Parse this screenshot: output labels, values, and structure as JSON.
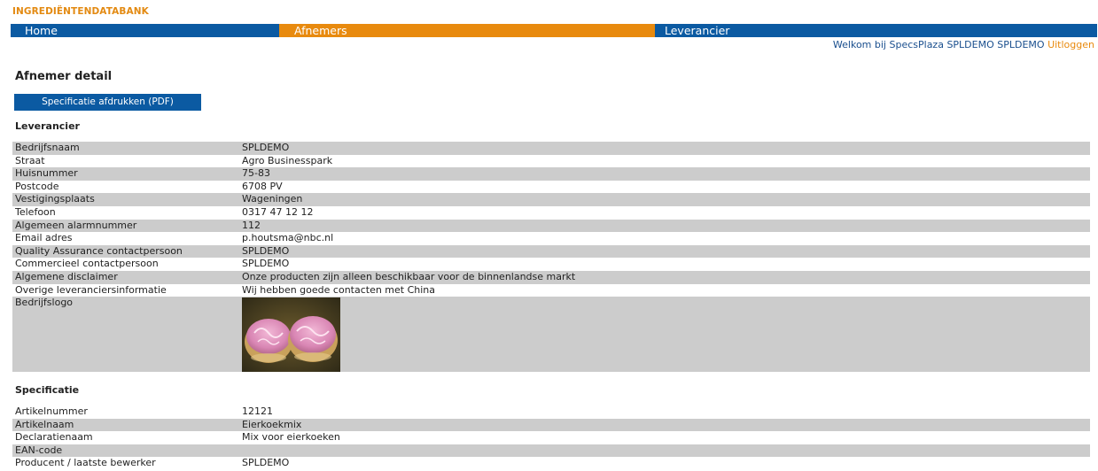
{
  "header": {
    "brand": "INGREDIËNTENDATABANK",
    "nav": [
      {
        "label": "Home"
      },
      {
        "label": "Afnemers"
      },
      {
        "label": "Leverancier"
      }
    ],
    "welcome_text": "Welkom bij SpecsPlaza SPLDEMO SPLDEMO",
    "logout_label": "Uitloggen"
  },
  "page": {
    "title": "Afnemer detail",
    "pdf_button": "Specificatie afdrukken (PDF)"
  },
  "leverancier": {
    "title": "Leverancier",
    "rows": [
      {
        "label": "Bedrijfsnaam",
        "value": "SPLDEMO"
      },
      {
        "label": "Straat",
        "value": "Agro Businesspark"
      },
      {
        "label": "Huisnummer",
        "value": "75-83"
      },
      {
        "label": "Postcode",
        "value": "6708 PV"
      },
      {
        "label": "Vestigingsplaats",
        "value": "Wageningen"
      },
      {
        "label": "Telefoon",
        "value": "0317 47 12 12"
      },
      {
        "label": "Algemeen alarmnummer",
        "value": "112"
      },
      {
        "label": "Email adres",
        "value": "p.houtsma@nbc.nl"
      },
      {
        "label": "Quality Assurance contactpersoon",
        "value": "SPLDEMO"
      },
      {
        "label": "Commercieel contactpersoon",
        "value": "SPLDEMO"
      },
      {
        "label": "Algemene disclaimer",
        "value": "Onze producten zijn alleen beschikbaar voor de binnenlandse markt"
      },
      {
        "label": "Overige leveranciersinformatie",
        "value": "Wij hebben goede contacten met China"
      }
    ],
    "logo_label": "Bedrijfslogo"
  },
  "specificatie": {
    "title": "Specificatie",
    "rows": [
      {
        "label": "Artikelnummer",
        "value": "12121"
      },
      {
        "label": "Artikelnaam",
        "value": "Eierkoekmix"
      },
      {
        "label": "Declaratienaam",
        "value": "Mix voor eierkoeken"
      },
      {
        "label": "EAN-code",
        "value": ""
      },
      {
        "label": "Producent / laatste bewerker",
        "value": "SPLDEMO"
      }
    ]
  },
  "colors": {
    "brand_orange": "#e38a12",
    "nav_blue": "#0b5aa2",
    "nav_orange": "#e88a0e",
    "row_grey": "#cccccc"
  }
}
